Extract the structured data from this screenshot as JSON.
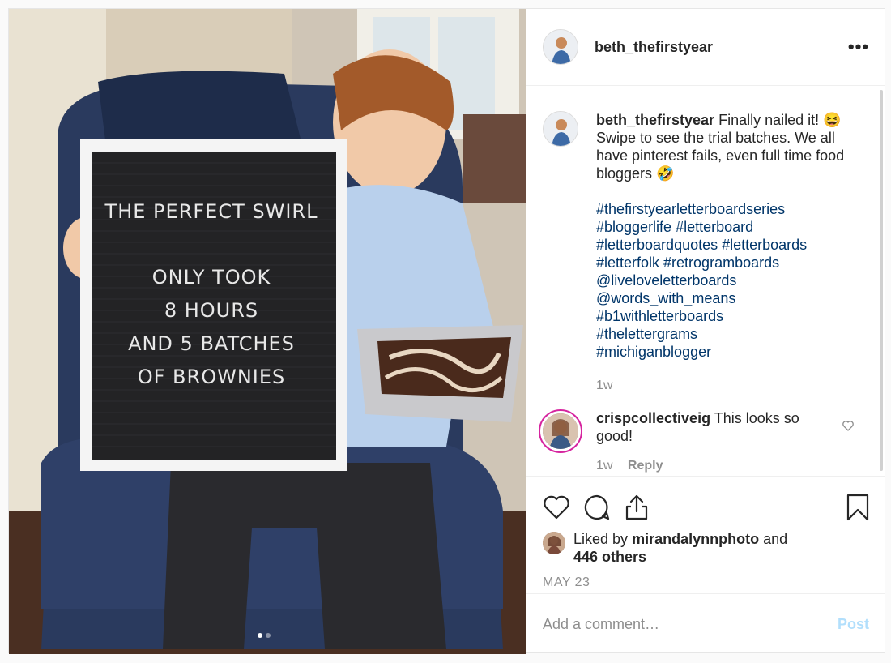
{
  "post": {
    "username": "beth_thefirstyear",
    "more_icon": "more-horizontal-icon",
    "photo": {
      "board_lines_top": [
        "THE PERFECT SWIRL"
      ],
      "board_lines_bottom": [
        "ONLY TOOK",
        "8 HOURS",
        "AND 5 BATCHES",
        "OF BROWNIES"
      ],
      "carousel_count": 2,
      "carousel_active": 1
    },
    "caption": {
      "username": "beth_thefirstyear",
      "text": "Finally nailed it! 😆 Swipe to see the trial batches. We all have pinterest fails, even full time food bloggers 🤣",
      "tags": [
        "#thefirstyearletterboardseries",
        "#bloggerlife #letterboard",
        "#letterboardquotes #letterboards",
        "#letterfolk #retrogramboards",
        "@liveloveletterboards",
        "@words_with_means",
        "#b1withletterboards",
        "#thelettergrams",
        "#michiganblogger"
      ],
      "time": "1w"
    },
    "comments": [
      {
        "username": "crispcollectiveig",
        "text": "This looks so good!",
        "time": "1w",
        "reply_label": "Reply"
      }
    ],
    "actions": {
      "like_icon": "heart-icon",
      "comment_icon": "comment-icon",
      "share_icon": "share-icon",
      "save_icon": "bookmark-icon"
    },
    "likes": {
      "prefix": "Liked by",
      "liker": "mirandalynnphoto",
      "and": "and",
      "others": "446 others"
    },
    "date": "MAY 23",
    "add_comment": {
      "placeholder": "Add a comment…",
      "post_label": "Post"
    },
    "colors": {
      "link": "#003569",
      "muted": "#8e8e8e",
      "post_disabled": "#b2dffc",
      "story_ring": "#d6249f"
    }
  }
}
